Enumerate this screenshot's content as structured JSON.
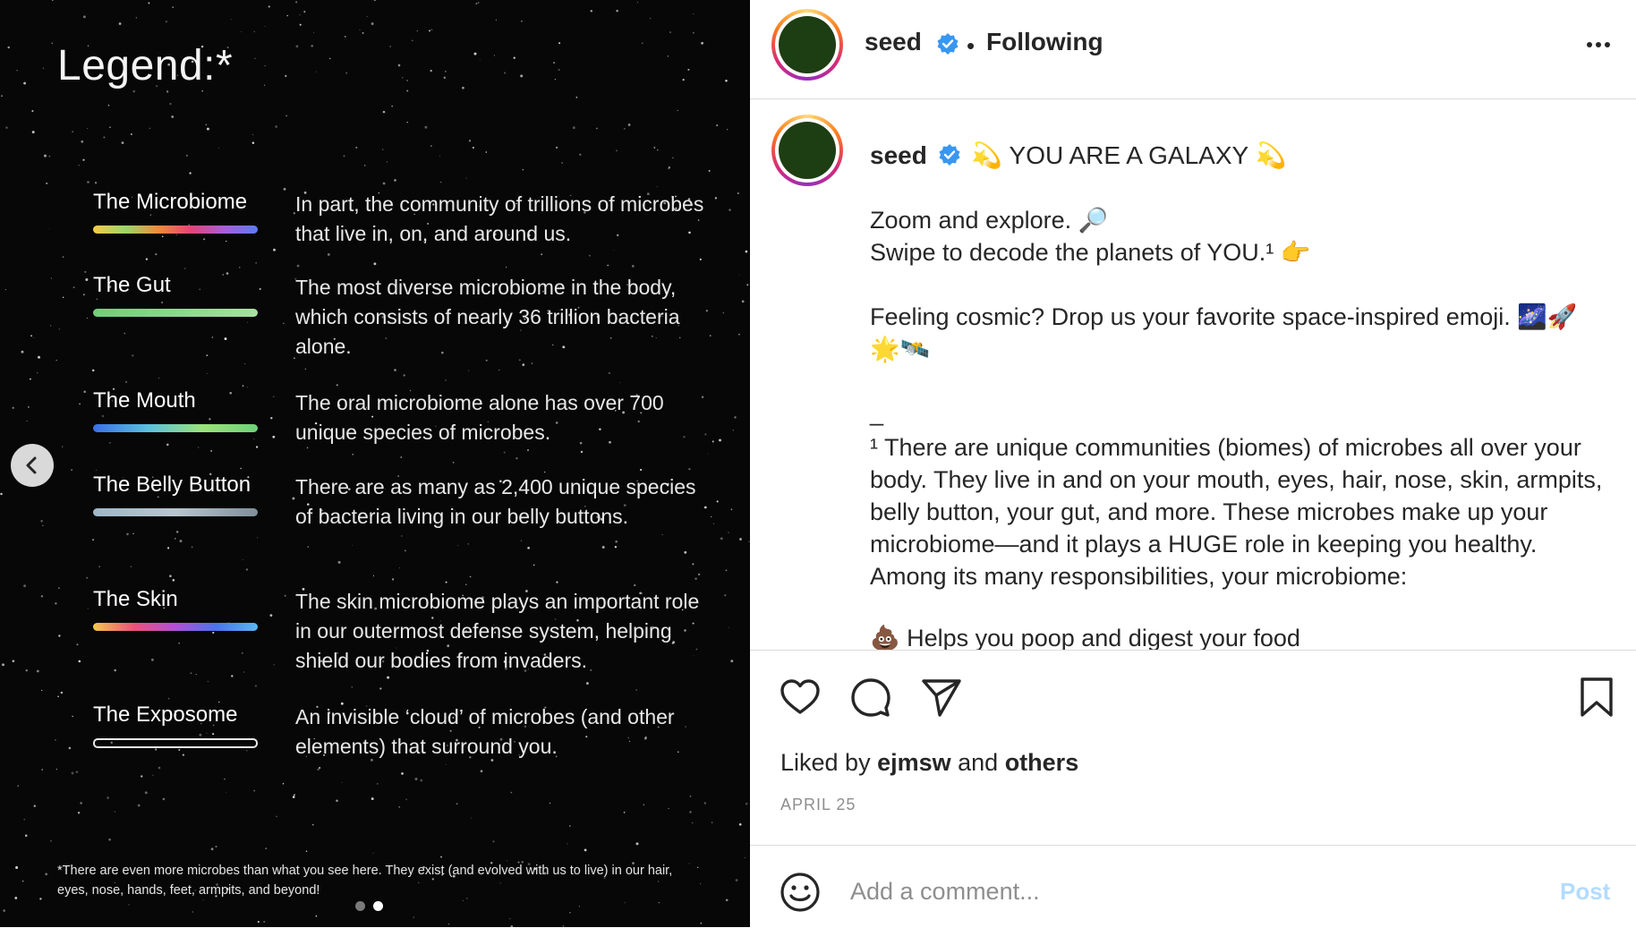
{
  "slide": {
    "legend_title": "Legend:*",
    "rows": [
      {
        "label": "The Microbiome",
        "desc": "In part, the community of trillions of microbes that live in, on, and around us.",
        "bar": "linear-gradient(90deg,#f7c948,#9bd66b,#f28a3c,#e0457b,#a85fd9,#5b7cf0)"
      },
      {
        "label": "The Gut",
        "desc": "The most diverse microbiome in the body, which consists of nearly 36 trillion bacteria alone.",
        "bar": "linear-gradient(90deg,#6fcf7a,#a8e0a0)"
      },
      {
        "label": "The Mouth",
        "desc": "The oral microbiome alone has over 700 unique species of microbes.",
        "bar": "linear-gradient(90deg,#3a6fe8,#5bc0de,#9be37a,#6fd17a)"
      },
      {
        "label": "The Belly Button",
        "desc": "There are as many as 2,400 unique species of bacteria living in our belly buttons.",
        "bar": "linear-gradient(90deg,#9fb8c8,#b8c6cf,#7f8f98)"
      },
      {
        "label": "The Skin",
        "desc": "The skin microbiome plays an important role in our outermost defense system, helping shield our bodies from invaders.",
        "bar": "linear-gradient(90deg,#f5c84a,#ef4f7b,#b24fd8,#4a74f0,#5ab7f2)"
      },
      {
        "label": "The Exposome",
        "desc": "An invisible ‘cloud’ of microbes (and other elements) that surround you.",
        "bar": "transparent"
      }
    ],
    "footnote": "*There are even more microbes than what you see here. They exist (and evolved with us to live) in our hair, eyes, nose, hands, feet, armpits, and beyond!",
    "active_dot": 2,
    "dot_count": 2
  },
  "header": {
    "username": "seed",
    "separator": "•",
    "follow_state": "Following",
    "more_icon": "more-horizontal-icon"
  },
  "caption": {
    "username": "seed",
    "headline": "💫 YOU ARE A GALAXY 💫",
    "line1": "Zoom and explore. 🔎",
    "line2": "Swipe to decode the planets of YOU.¹ 👉",
    "line3": "Feeling cosmic? Drop us your favorite space-inspired emoji. 🌌🚀",
    "line4": "🌟🛰️",
    "divider": "_",
    "footnote_para": "¹ There are unique communities (biomes) of microbes all over your body. They live in and on your mouth, eyes, hair, nose, skin, armpits, belly button, your gut, and more. These microbes make up your microbiome—and it plays a HUGE role in keeping you healthy. Among its many responsibilities, your microbiome:",
    "partial_line": "💩 Helps you poop and digest your food"
  },
  "actions": {
    "liked_prefix": "Liked by ",
    "liked_user": "ejmsw",
    "liked_mid": " and ",
    "liked_others": "others",
    "date": "APRIL 25"
  },
  "comment": {
    "placeholder": "Add a comment...",
    "post_label": "Post"
  },
  "colors": {
    "avatar": "#1d3d13",
    "verified": "#3897f0",
    "post_disabled": "#b3dbff"
  }
}
